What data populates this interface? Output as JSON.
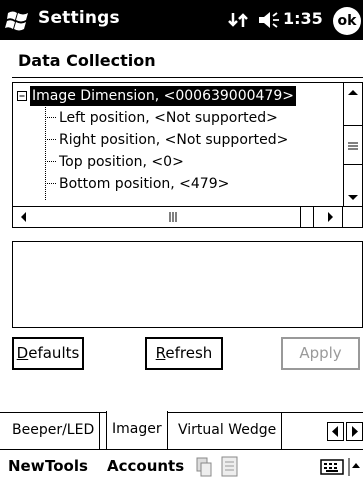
{
  "titlebar": {
    "title": "Settings",
    "clock": "1:35",
    "ok_label": "ok"
  },
  "heading": "Data Collection",
  "tree": {
    "root": "Image Dimension, <000639000479>",
    "children": [
      "Left position, <Not supported>",
      "Right position, <Not supported>",
      "Top position, <0>",
      "Bottom position, <479>"
    ]
  },
  "buttons": {
    "defaults_first": "D",
    "defaults_rest": "efaults",
    "refresh_first": "R",
    "refresh_rest": "efresh",
    "apply": "Apply"
  },
  "tabs": [
    "Beeper/LED",
    "Imager",
    "Virtual Wedge"
  ],
  "active_tab": "Imager",
  "menubar": {
    "new": "New",
    "tools": "Tools",
    "accounts": "Accounts"
  }
}
